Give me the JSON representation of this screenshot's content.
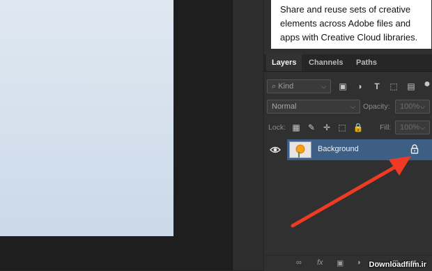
{
  "tip_text": "Share and reuse sets of creative elements across Adobe files and apps with Creative Cloud libraries.",
  "tabs": [
    "Layers",
    "Channels",
    "Paths"
  ],
  "filter": {
    "label": "Kind"
  },
  "blend": {
    "mode": "Normal",
    "opacity_label": "Opacity:",
    "opacity_value": "100%"
  },
  "lock": {
    "label": "Lock:",
    "fill_label": "Fill:",
    "fill_value": "100%"
  },
  "layer": {
    "name": "Background"
  },
  "bottom_icons": [
    "link-icon",
    "fx-icon",
    "mask-icon",
    "adjustment-icon",
    "group-icon",
    "new-layer-icon",
    "trash-icon"
  ],
  "watermark": "Downloadfilm.ir",
  "colors": {
    "selection": "#3e5f85",
    "arrow": "#f03a24",
    "panel": "#303030"
  }
}
